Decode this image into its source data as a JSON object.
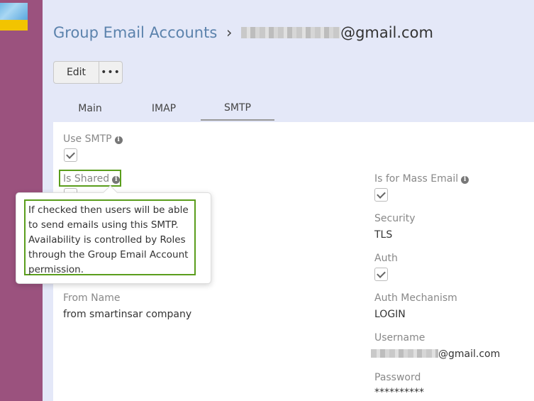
{
  "app": {
    "logo_icon": "app-logo-icon"
  },
  "header": {
    "crumb": "Group Email Accounts",
    "separator": "›",
    "email_suffix": "@gmail.com"
  },
  "toolbar": {
    "edit_label": "Edit",
    "more_label": "•••"
  },
  "tabs": [
    {
      "label": "Main",
      "active": false
    },
    {
      "label": "IMAP",
      "active": false
    },
    {
      "label": "SMTP",
      "active": true
    }
  ],
  "fields": {
    "use_smtp": {
      "label": "Use SMTP",
      "checked": true
    },
    "is_shared": {
      "label": "Is Shared",
      "checked": true
    },
    "is_mass_email": {
      "label": "Is for Mass Email",
      "checked": true
    },
    "security": {
      "label": "Security",
      "value": "TLS"
    },
    "auth": {
      "label": "Auth",
      "checked": true
    },
    "from_name": {
      "label": "From Name",
      "value": "from smartinsar company"
    },
    "auth_mechanism": {
      "label": "Auth Mechanism",
      "value": "LOGIN"
    },
    "username": {
      "label": "Username",
      "value_suffix": "@gmail.com"
    },
    "password": {
      "label": "Password",
      "value": "**********"
    }
  },
  "tooltip": {
    "text": "If checked then users will be able to send emails using this SMTP. Availability is controlled by Roles through the Group Email Account permission."
  },
  "colors": {
    "sidebar": "#9b527e",
    "background": "#e4e8f8",
    "link": "#5b82ac",
    "highlight": "#5a9d1c"
  }
}
